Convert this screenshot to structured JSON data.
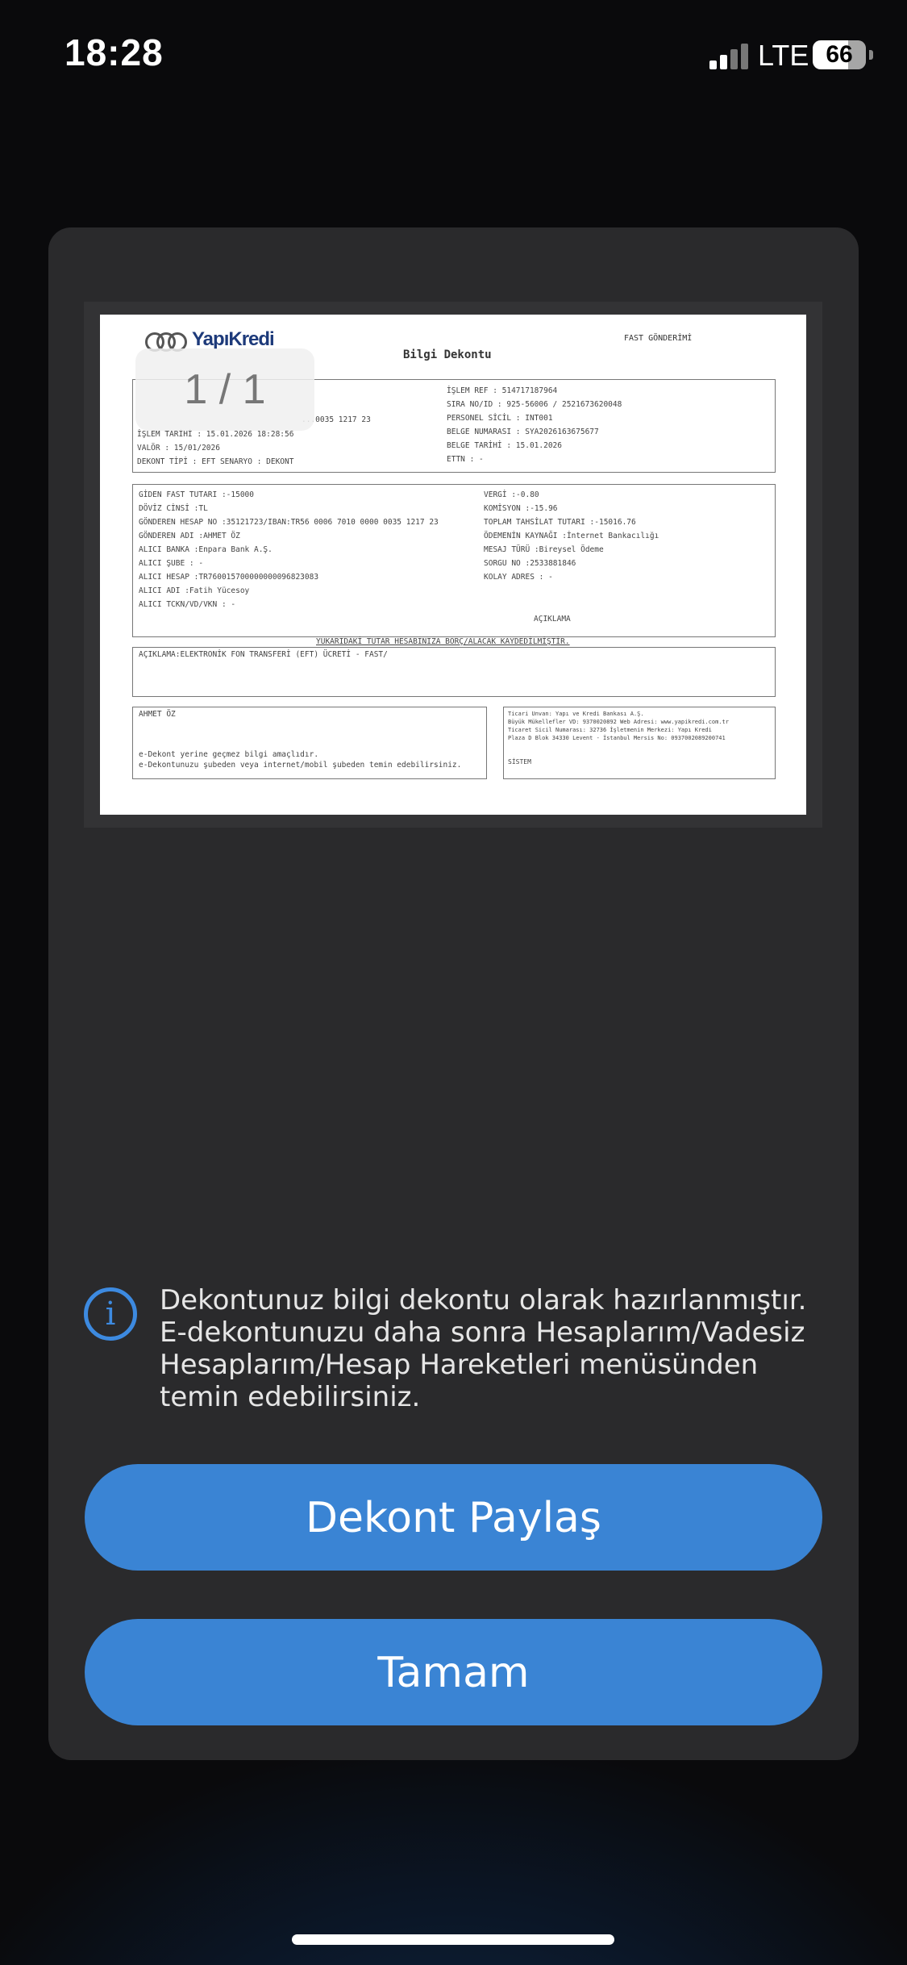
{
  "status_bar": {
    "time": "18:28",
    "network": "LTE",
    "battery": "66"
  },
  "document": {
    "brand": "YapıKredi",
    "title": "Bilgi Dekontu",
    "fast_label": "FAST GÖNDERİMİ",
    "page_indicator": "1 / 1",
    "header_left": [
      "...0035 1217 23",
      "İŞLEM TARİHİ : 15.01.2026 18:28:56",
      "VALÖR        : 15/01/2026",
      "DEKONT TİPİ  : EFT         SENARYO : DEKONT"
    ],
    "header_right": [
      "İŞLEM REF      : 514717187964",
      "SIRA NO/ID     : 925-56006 / 2521673620048",
      "PERSONEL SİCİL : INT001",
      "BELGE NUMARASI : SYA2026163675677",
      "BELGE TARİHİ   : 15.01.2026",
      "ETTN           : -"
    ],
    "detail_left": [
      "GİDEN FAST TUTARI :-15000",
      "DÖVİZ CİNSİ       :TL",
      "GÖNDEREN HESAP NO :35121723/IBAN:TR56 0006 7010 0000 0035 1217 23",
      "GÖNDEREN ADI      :AHMET ÖZ",
      "ALICI BANKA       :Enpara Bank A.Ş.",
      "ALICI ŞUBE        : -",
      "ALICI HESAP       :TR760015700000000096823083",
      "ALICI ADI         :Fatih Yücesoy",
      "ALICI TCKN/VD/VKN : -"
    ],
    "detail_right": [
      "VERGİ                  :-0.80",
      "KOMİSYON               :-15.96",
      "TOPLAM TAHSİLAT TUTARI :-15016.76",
      "ÖDEMENİN KAYNAĞI       :İnternet Bankacılığı",
      "MESAJ TÜRÜ             :Bireysel Ödeme",
      "SORGU NO               :2533881846",
      "KOLAY ADRES            : -"
    ],
    "aciklama_label": "AÇIKLAMA",
    "notice_line": "YUKARIDAKİ TUTAR HESABINIZA BORÇ/ALACAK KAYDEDİLMİŞTİR.",
    "aciklama_text": "AÇIKLAMA:ELEKTRONİK FON TRANSFERİ (EFT) ÜCRETİ - FAST/",
    "footer_left_name": "AHMET ÖZ",
    "footer_left_lines": [
      "e-Dekont yerine geçmez bilgi amaçlıdır.",
      "e-Dekontunuzu şubeden veya internet/mobil şubeden temin edebilirsiniz."
    ],
    "footer_right_lines": [
      "Ticari Unvan: Yapı ve Kredi Bankası A.Ş.",
      "Büyük Mükellefler VD: 9370020892 Web Adresi: www.yapikredi.com.tr",
      "Ticaret Sicil Numarası: 32736 İşletmenin Merkezi: Yapı Kredi",
      "Plaza D Blok 34330 Levent - İstanbul Mersis No: 0937002089200741"
    ],
    "footer_right_sign": "SİSTEM"
  },
  "info": {
    "icon": "info-icon",
    "text": "Dekontunuz bilgi dekontu olarak hazırlanmıştır. E-dekontunuzu daha sonra Hesaplarım/Vadesiz Hesaplarım/Hesap Hareketleri menüsünden temin edebilirsiniz."
  },
  "buttons": {
    "share": "Dekont Paylaş",
    "ok": "Tamam"
  },
  "colors": {
    "primary_button": "#3a84d4",
    "card": "#2a2a2c",
    "info_icon": "#3d8ae0"
  }
}
